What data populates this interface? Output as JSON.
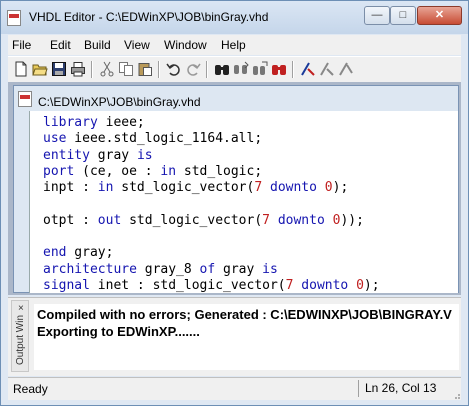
{
  "window": {
    "title": "VHDL Editor - C:\\EDWinXP\\JOB\\binGray.vhd"
  },
  "title_buttons": {
    "minimize": "—",
    "maximize": "□",
    "close": "✕"
  },
  "menu": [
    "File",
    "Edit",
    "Build",
    "View",
    "Window",
    "Help"
  ],
  "toolbar": {
    "icons": [
      "new-file-icon",
      "open-folder-icon",
      "save-icon",
      "print-icon",
      "cut-icon",
      "copy-icon",
      "paste-icon",
      "undo-icon",
      "redo-icon",
      "find-icon",
      "find-next-icon",
      "replace-icon",
      "find-all-icon",
      "compile-icon",
      "tool-a-icon",
      "tool-b-icon"
    ]
  },
  "document": {
    "title": "C:\\EDWinXP\\JOB\\binGray.vhd",
    "lines": [
      [
        [
          "kw",
          "library"
        ],
        [
          "t",
          " ieee;"
        ]
      ],
      [
        [
          "kw",
          "use"
        ],
        [
          "t",
          " ieee.std_logic_1164.all;"
        ]
      ],
      [
        [
          "kw",
          "entity"
        ],
        [
          "t",
          " gray "
        ],
        [
          "kw",
          "is"
        ]
      ],
      [
        [
          "kw",
          "port"
        ],
        [
          "t",
          " (ce, oe : "
        ],
        [
          "kw",
          "in"
        ],
        [
          "t",
          " std_logic;"
        ]
      ],
      [
        [
          "t",
          "inpt : "
        ],
        [
          "kw",
          "in"
        ],
        [
          "t",
          " std_logic_vector("
        ],
        [
          "num",
          "7"
        ],
        [
          "t",
          " "
        ],
        [
          "kw",
          "downto"
        ],
        [
          "t",
          " "
        ],
        [
          "num",
          "0"
        ],
        [
          "t",
          ");"
        ]
      ],
      [
        [
          "t",
          ""
        ]
      ],
      [
        [
          "t",
          "otpt : "
        ],
        [
          "kw",
          "out"
        ],
        [
          "t",
          " std_logic_vector("
        ],
        [
          "num",
          "7"
        ],
        [
          "t",
          " "
        ],
        [
          "kw",
          "downto"
        ],
        [
          "t",
          " "
        ],
        [
          "num",
          "0"
        ],
        [
          "t",
          "));"
        ]
      ],
      [
        [
          "t",
          ""
        ]
      ],
      [
        [
          "kw",
          "end"
        ],
        [
          "t",
          " gray;"
        ]
      ],
      [
        [
          "kw",
          "architecture"
        ],
        [
          "t",
          " gray_8 "
        ],
        [
          "kw",
          "of"
        ],
        [
          "t",
          " gray "
        ],
        [
          "kw",
          "is"
        ]
      ],
      [
        [
          "kw",
          "signal"
        ],
        [
          "t",
          " inet : std_logic_vector("
        ],
        [
          "num",
          "7"
        ],
        [
          "t",
          " "
        ],
        [
          "kw",
          "downto"
        ],
        [
          "t",
          " "
        ],
        [
          "num",
          "0"
        ],
        [
          "t",
          ");"
        ]
      ]
    ]
  },
  "output": {
    "label": "Output Win",
    "close": "×",
    "lines": [
      "Compiled with no errors; Generated : C:\\EDWINXP\\JOB\\BINGRAY.V",
      "Exporting to EDWinXP......."
    ]
  },
  "status": {
    "left": "Ready",
    "position": "Ln 26, Col 13"
  },
  "colors": {
    "keyword": "#1515b0",
    "number": "#c02020",
    "title_bar": "#c5d6ea",
    "close_button": "#c74c34"
  }
}
